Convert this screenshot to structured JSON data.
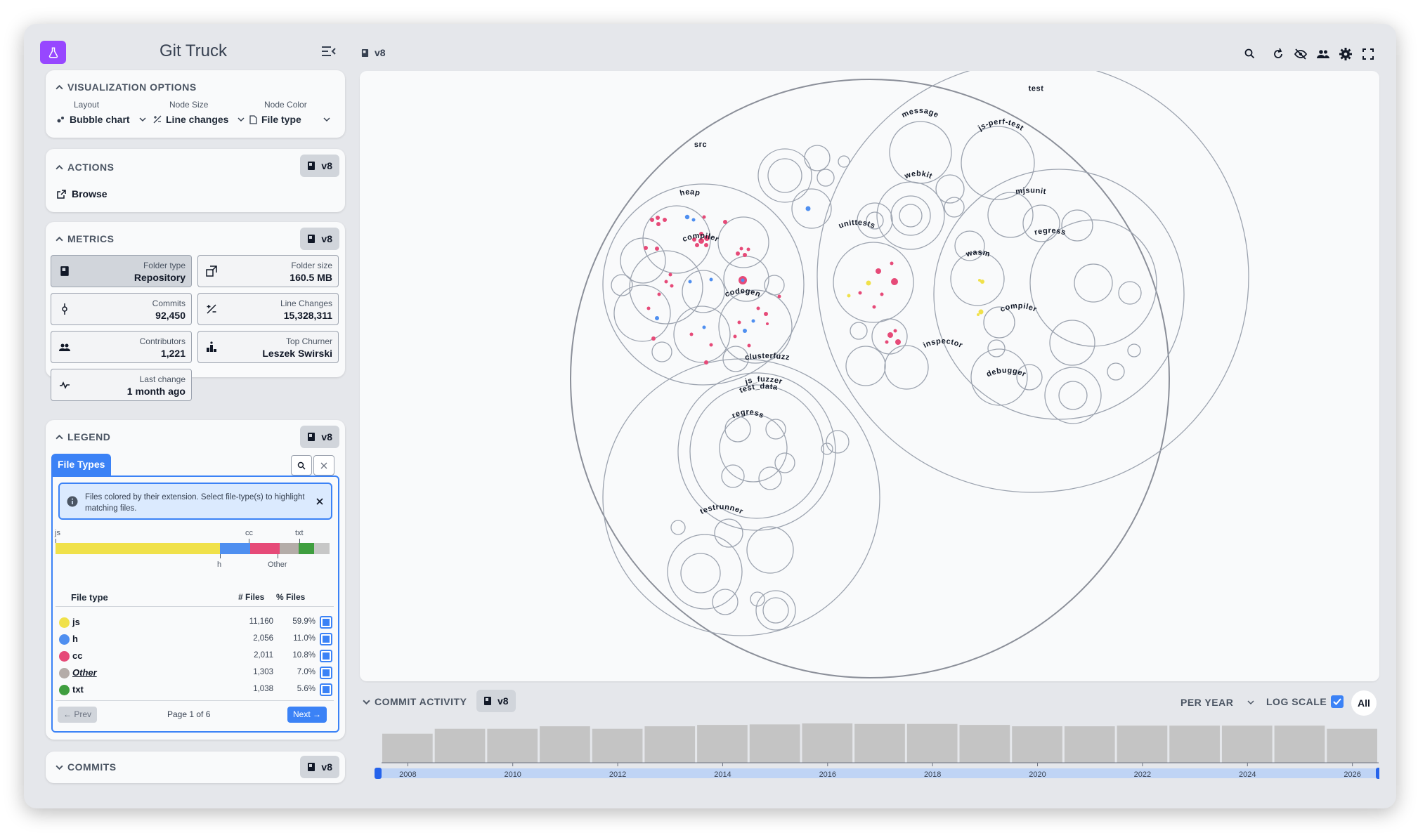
{
  "app": {
    "title": "Git Truck",
    "repo": "v8"
  },
  "viz_options": {
    "title": "VISUALIZATION OPTIONS",
    "layout_label": "Layout",
    "layout_value": "Bubble chart",
    "size_label": "Node Size",
    "size_value": "Line changes",
    "color_label": "Node Color",
    "color_value": "File type"
  },
  "actions": {
    "title": "ACTIONS",
    "scope": "v8",
    "browse": "Browse"
  },
  "metrics": {
    "title": "METRICS",
    "scope": "v8",
    "items": [
      {
        "label": "Folder type",
        "value": "Repository"
      },
      {
        "label": "Folder size",
        "value": "160.5 MB"
      },
      {
        "label": "Commits",
        "value": "92,450"
      },
      {
        "label": "Line Changes",
        "value": "15,328,311"
      },
      {
        "label": "Contributors",
        "value": "1,221"
      },
      {
        "label": "Top Churner",
        "value": "Leszek Swirski"
      },
      {
        "label": "Last change",
        "value": "1 month ago"
      }
    ]
  },
  "legend": {
    "title": "LEGEND",
    "scope": "v8",
    "tab": "File Types",
    "info": "Files colored by their extension. Select file-type(s) to highlight matching files.",
    "dist_labels_top": [
      "js",
      "cc",
      "txt"
    ],
    "dist_labels_bottom": [
      "h",
      "Other"
    ],
    "headers": {
      "type": "File type",
      "files": "# Files",
      "pct": "% Files"
    },
    "rows": [
      {
        "name": "js",
        "count": "11,160",
        "pct": "59.9%",
        "color": "#f0e14a",
        "share": 59.9
      },
      {
        "name": "h",
        "count": "2,056",
        "pct": "11.0%",
        "color": "#4f8ff0",
        "share": 11.0
      },
      {
        "name": "cc",
        "count": "2,011",
        "pct": "10.8%",
        "color": "#e64a78",
        "share": 10.8
      },
      {
        "name": "Other",
        "count": "1,303",
        "pct": "7.0%",
        "color": "#b4aca8",
        "share": 7.0
      },
      {
        "name": "txt",
        "count": "1,038",
        "pct": "5.6%",
        "color": "#3f9e3f",
        "share": 5.6
      }
    ],
    "prev": "← Prev",
    "page": "Page 1 of 6",
    "next": "Next →"
  },
  "commits": {
    "title": "COMMITS",
    "scope": "v8"
  },
  "bubble": {
    "root": "v8",
    "labels": [
      "test",
      "message",
      "js-perf-test",
      "webkit",
      "mjsunit",
      "unittests",
      "regress",
      "wasm",
      "compiler",
      "inspector",
      "debugger",
      "src",
      "heap",
      "compiler",
      "codegen",
      "clusterfuzz",
      "js_fuzzer",
      "test_data",
      "regress",
      "testrunner"
    ]
  },
  "commit_activity": {
    "title": "COMMIT ACTIVITY",
    "scope": "v8",
    "period": "PER YEAR",
    "log_scale": "LOG SCALE",
    "all": "All"
  },
  "chart_data": {
    "type": "bar",
    "title": "",
    "xlabel": "",
    "ylabel": "",
    "log_scale": true,
    "categories": [
      "2008",
      "2009",
      "2010",
      "2011",
      "2012",
      "2013",
      "2014",
      "2015",
      "2016",
      "2017",
      "2018",
      "2019",
      "2020",
      "2021",
      "2022",
      "2023",
      "2024",
      "2025",
      "2026"
    ],
    "values": [
      520,
      1500,
      1500,
      2600,
      1500,
      2600,
      3500,
      3900,
      4800,
      4300,
      4300,
      3500,
      2600,
      2600,
      3000,
      3000,
      3000,
      3000,
      1500
    ],
    "x_ticks": [
      "2008",
      "2010",
      "2012",
      "2014",
      "2016",
      "2018",
      "2020",
      "2022",
      "2024",
      "2026"
    ]
  }
}
